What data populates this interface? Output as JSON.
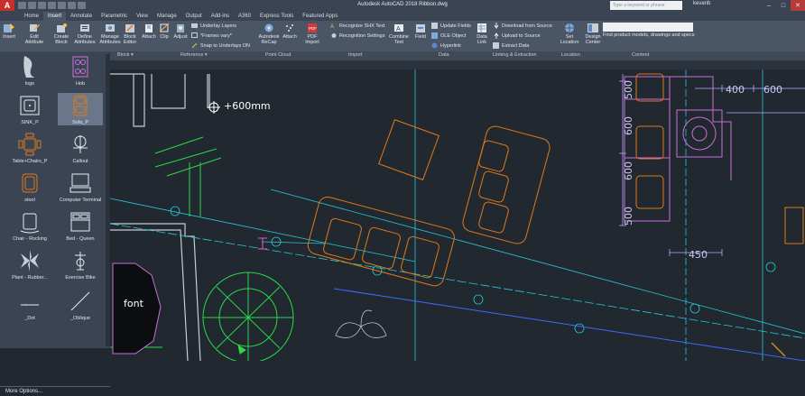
{
  "titlebar": {
    "app_button": "A",
    "title": "Autodesk AutoCAD 2018   Ribbon.dwg",
    "search_placeholder": "Type a keyword or phrase",
    "user": "kevanb",
    "min": "–",
    "max": "□",
    "close": "✕"
  },
  "tabs": [
    "Home",
    "Insert",
    "Annotate",
    "Parametric",
    "View",
    "Manage",
    "Output",
    "Add-ins",
    "A360",
    "Express Tools",
    "Featured Apps"
  ],
  "active_tab": "Insert",
  "ribbon": {
    "insert": "Insert",
    "edit_attribute": "Edit Attribute",
    "create_block": "Create Block",
    "define_attributes": "Define Attributes",
    "manage_attributes": "Manage Attributes",
    "block_editor": "Block Editor",
    "attach": "Attach",
    "clip": "Clip",
    "adjust": "Adjust",
    "underlay_layers": "Underlay Layers",
    "frames_vary": "*Frames vary*",
    "snap_underlays": "Snap to Underlays ON",
    "autodesk_recap": "Autodesk ReCap",
    "attach2": "Attach",
    "pdf_import": "PDF Import",
    "recognize_shx": "Recognize SHX Text",
    "recognition_settings": "Recognition Settings",
    "combine_text": "Combine Text",
    "field": "Field",
    "update_fields": "Update Fields",
    "ole_object": "OLE Object",
    "hyperlink": "Hyperlink",
    "data_link": "Data Link",
    "download_from_source": "Download from Source",
    "upload_to_source": "Upload to Source",
    "extract_data": "Extract  Data",
    "set_location": "Set Location",
    "design_center": "Design Center",
    "find_product": "Find product models, drawings and specs"
  },
  "panels": {
    "block": "Block ▾",
    "reference": "Reference ▾",
    "point_cloud": "Point Cloud",
    "import": "Import",
    "data": "Data",
    "linking": "Linking & Extraction",
    "location": "Location",
    "content": "Content"
  },
  "palette": {
    "items": [
      "logo",
      "Hob",
      "SINK_P",
      "Sofa_P",
      "Table+Chairs_P",
      "Callout",
      "stool",
      "Computer Terminal",
      "Chair - Rocking",
      "Bed - Queen",
      "Plant - Rubber...",
      "Exercise Bike",
      "_Dot",
      "_Oblique"
    ],
    "selected": "Sofa_P",
    "more_options": "More Options..."
  },
  "drawing": {
    "annotation": "+600mm",
    "font_label": "font",
    "dims": [
      "400",
      "600",
      "600",
      "600",
      "500",
      "500",
      "450"
    ]
  },
  "colors": {
    "canvas": "#212830",
    "ribbon": "#4a5566",
    "cyan": "#26c9d9",
    "green": "#2bd84a",
    "orange": "#e0791a",
    "magenta": "#c86fd7",
    "dims": "#b9a7ff",
    "blue": "#3b6bff",
    "accent": "#d88417"
  }
}
